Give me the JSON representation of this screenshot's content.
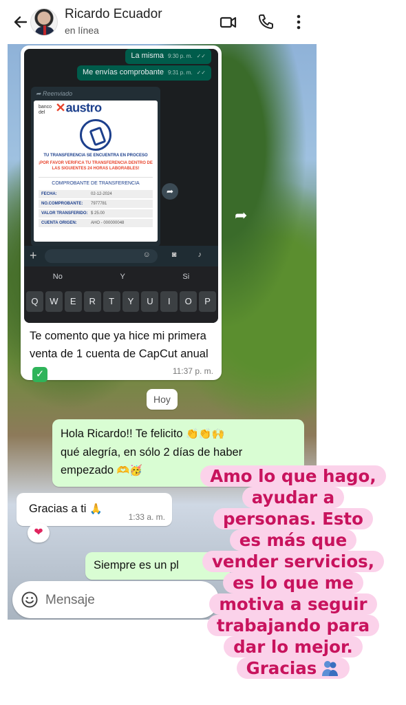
{
  "header": {
    "contact_name": "Ricardo Ecuador",
    "status": "en línea"
  },
  "forwarded_shot": {
    "bubbles": [
      {
        "text": "La misma",
        "time": "9:30 p. m."
      },
      {
        "text": "Me envías comprobante",
        "time": "9:31 p. m."
      }
    ],
    "forwarded_label": "Reenviado",
    "bank_prefix": "banco del",
    "bank_brand": "austro",
    "line1": "TU TRANSFERENCIA SE ENCUENTRA EN PROCESO",
    "line2": "¡POR FAVOR VERIFICA TU TRANSFERENCIA DENTRO DE LAS SIGUIENTES 24 HORAS LABORABLES!",
    "receipt_title": "COMPROBANTE DE TRANSFERENCIA",
    "rows": [
      {
        "label": "FECHA:",
        "value": "02-12-2024"
      },
      {
        "label": "NO.COMPROBANTE:",
        "value": "7977781"
      },
      {
        "label": "VALOR TRANSFERIDO:",
        "value": "$ 25.00"
      },
      {
        "label": "CUENTA ORIGEN:",
        "value": "AHO - 000000048"
      }
    ],
    "suggestions": [
      "No",
      "Y",
      "Si"
    ],
    "keys": [
      "Q",
      "W",
      "E",
      "R",
      "T",
      "Y",
      "U",
      "I",
      "O",
      "P"
    ]
  },
  "messages": {
    "caption": "Te comento que ya hice mi primera venta de 1 cuenta de CapCut anual",
    "caption_time": "11:37 p. m.",
    "date_chip": "Hoy",
    "out1": "Hola Ricardo!! Te felicito",
    "out1_line2": "qué alegría, en sólo 2 días de haber empezado",
    "in2": "Gracias a ti",
    "in2_time": "1:33 a. m.",
    "out3": "Siempre es un pl"
  },
  "compose": {
    "placeholder": "Mensaje"
  },
  "overlay": {
    "lines": [
      "Amo lo que hago,",
      "ayudar a",
      "personas. Esto",
      "es más que",
      "vender servicios,",
      "es lo que me",
      "motiva a seguir",
      "trabajando para",
      "dar lo mejor.",
      "Gracias"
    ]
  },
  "colors": {
    "outgoing_bubble": "#d9fdd3",
    "incoming_bubble": "#ffffff",
    "overlay_bg": "#fbd2ea",
    "overlay_text": "#c8135d"
  }
}
